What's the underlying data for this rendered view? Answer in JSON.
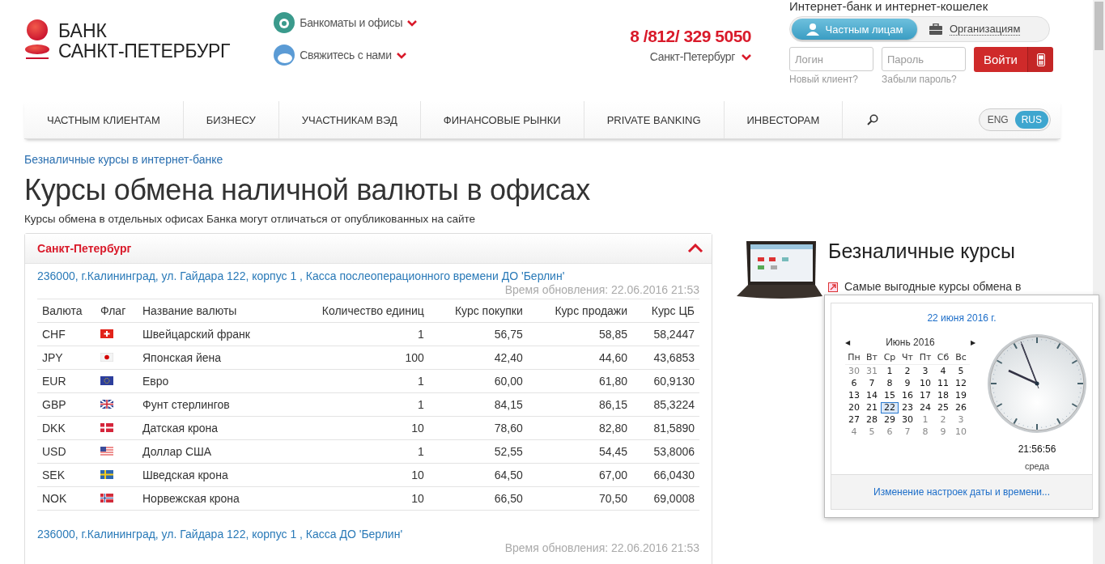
{
  "header": {
    "logo": {
      "line1": "БАНК",
      "line2": "САНКТ-ПЕТЕРБУРГ"
    },
    "links": [
      {
        "label": "Банкоматы и офисы"
      },
      {
        "label": "Свяжитесь с нами"
      }
    ],
    "phone": "8 /812/ 329 5050",
    "city": "Санкт-Петербург",
    "ibank": {
      "title": "Интернет-банк и интернет-кошелек",
      "tabs": [
        {
          "label": "Частным лицам",
          "selected": true
        },
        {
          "label": "Организациям",
          "selected": false
        }
      ],
      "login_placeholder": "Логин",
      "password_placeholder": "Пароль",
      "submit": "Войти",
      "new_client": "Новый клиент?",
      "forgot": "Забыли пароль?"
    }
  },
  "nav": {
    "items": [
      "ЧАСТНЫМ КЛИЕНТАМ",
      "БИЗНЕСУ",
      "УЧАСТНИКАМ ВЭД",
      "ФИНАНСОВЫЕ РЫНКИ",
      "PRIVATE BANKING",
      "ИНВЕСТОРАМ"
    ],
    "languages": [
      {
        "label": "ENG",
        "selected": false
      },
      {
        "label": "RUS",
        "selected": true
      }
    ]
  },
  "breadcrumb": "Безналичные курсы в интернет-банке",
  "title": "Курсы обмена наличной валюты в офисах",
  "subtitle": "Курсы обмена в отдельных офисах Банка могут отличаться от опубликованных на сайте",
  "panel": {
    "title": "Санкт-Петербург",
    "expanded": true,
    "offices": [
      {
        "address": "236000, г.Калининград, ул. Гайдара 122, корпус 1 , Касса послеоперационного времени ДО 'Берлин'",
        "updated": "Время обновления: 22.06.2016 21:53",
        "table": {
          "columns": [
            "Валюта",
            "Флаг",
            "Название валюты",
            "Количество единиц",
            "Курс покупки",
            "Курс продажи",
            "Курс ЦБ"
          ],
          "rows": [
            {
              "code": "CHF",
              "name": "Швейцарский франк",
              "units": "1",
              "buy": "56,75",
              "sell": "58,85",
              "cb": "58,2447"
            },
            {
              "code": "JPY",
              "name": "Японская йена",
              "units": "100",
              "buy": "42,40",
              "sell": "44,60",
              "cb": "43,6853"
            },
            {
              "code": "EUR",
              "name": "Евро",
              "units": "1",
              "buy": "60,00",
              "sell": "61,80",
              "cb": "60,9130"
            },
            {
              "code": "GBP",
              "name": "Фунт стерлингов",
              "units": "1",
              "buy": "84,15",
              "sell": "86,15",
              "cb": "85,3224"
            },
            {
              "code": "DKK",
              "name": "Датская крона",
              "units": "10",
              "buy": "78,60",
              "sell": "82,80",
              "cb": "81,5890"
            },
            {
              "code": "USD",
              "name": "Доллар США",
              "units": "1",
              "buy": "52,55",
              "sell": "54,45",
              "cb": "53,8006"
            },
            {
              "code": "SEK",
              "name": "Шведская крона",
              "units": "10",
              "buy": "64,50",
              "sell": "67,00",
              "cb": "66,0430"
            },
            {
              "code": "NOK",
              "name": "Норвежская крона",
              "units": "10",
              "buy": "66,50",
              "sell": "70,50",
              "cb": "69,0008"
            }
          ]
        }
      },
      {
        "address": "236000, г.Калининград, ул. Гайдара 122, корпус 1 , Касса ДО 'Берлин'",
        "updated": "Время обновления: 22.06.2016 21:53"
      }
    ]
  },
  "sidebar": {
    "title": "Безналичные курсы",
    "links": [
      "Самые выгодные курсы обмена в"
    ]
  },
  "calendar_popup": {
    "date_link": "22 июня 2016 г.",
    "month": "Июнь 2016",
    "prev": "◀",
    "next": "▶",
    "weekdays": [
      "Пн",
      "Вт",
      "Ср",
      "Чт",
      "Пт",
      "Сб",
      "Вс"
    ],
    "weeks": [
      [
        {
          "n": "30",
          "other": true,
          "selected": false
        },
        {
          "n": "31",
          "other": true,
          "selected": false
        },
        {
          "n": "1",
          "other": false,
          "selected": false
        },
        {
          "n": "2",
          "other": false,
          "selected": false
        },
        {
          "n": "3",
          "other": false,
          "selected": false
        },
        {
          "n": "4",
          "other": false,
          "selected": false
        },
        {
          "n": "5",
          "other": false,
          "selected": false
        }
      ],
      [
        {
          "n": "6",
          "other": false,
          "selected": false
        },
        {
          "n": "7",
          "other": false,
          "selected": false
        },
        {
          "n": "8",
          "other": false,
          "selected": false
        },
        {
          "n": "9",
          "other": false,
          "selected": false
        },
        {
          "n": "10",
          "other": false,
          "selected": false
        },
        {
          "n": "11",
          "other": false,
          "selected": false
        },
        {
          "n": "12",
          "other": false,
          "selected": false
        }
      ],
      [
        {
          "n": "13",
          "other": false,
          "selected": false
        },
        {
          "n": "14",
          "other": false,
          "selected": false
        },
        {
          "n": "15",
          "other": false,
          "selected": false
        },
        {
          "n": "16",
          "other": false,
          "selected": false
        },
        {
          "n": "17",
          "other": false,
          "selected": false
        },
        {
          "n": "18",
          "other": false,
          "selected": false
        },
        {
          "n": "19",
          "other": false,
          "selected": false
        }
      ],
      [
        {
          "n": "20",
          "other": false,
          "selected": false
        },
        {
          "n": "21",
          "other": false,
          "selected": false
        },
        {
          "n": "22",
          "other": false,
          "selected": true
        },
        {
          "n": "23",
          "other": false,
          "selected": false
        },
        {
          "n": "24",
          "other": false,
          "selected": false
        },
        {
          "n": "25",
          "other": false,
          "selected": false
        },
        {
          "n": "26",
          "other": false,
          "selected": false
        }
      ],
      [
        {
          "n": "27",
          "other": false,
          "selected": false
        },
        {
          "n": "28",
          "other": false,
          "selected": false
        },
        {
          "n": "29",
          "other": false,
          "selected": false
        },
        {
          "n": "30",
          "other": false,
          "selected": false
        },
        {
          "n": "1",
          "other": true,
          "selected": false
        },
        {
          "n": "2",
          "other": true,
          "selected": false
        },
        {
          "n": "3",
          "other": true,
          "selected": false
        }
      ],
      [
        {
          "n": "4",
          "other": true,
          "selected": false
        },
        {
          "n": "5",
          "other": true,
          "selected": false
        },
        {
          "n": "6",
          "other": true,
          "selected": false
        },
        {
          "n": "7",
          "other": true,
          "selected": false
        },
        {
          "n": "8",
          "other": true,
          "selected": false
        },
        {
          "n": "9",
          "other": true,
          "selected": false
        },
        {
          "n": "10",
          "other": true,
          "selected": false
        }
      ]
    ],
    "time": "21:56:56",
    "weekday": "среда",
    "settings_link": "Изменение настроек даты и времени..."
  }
}
